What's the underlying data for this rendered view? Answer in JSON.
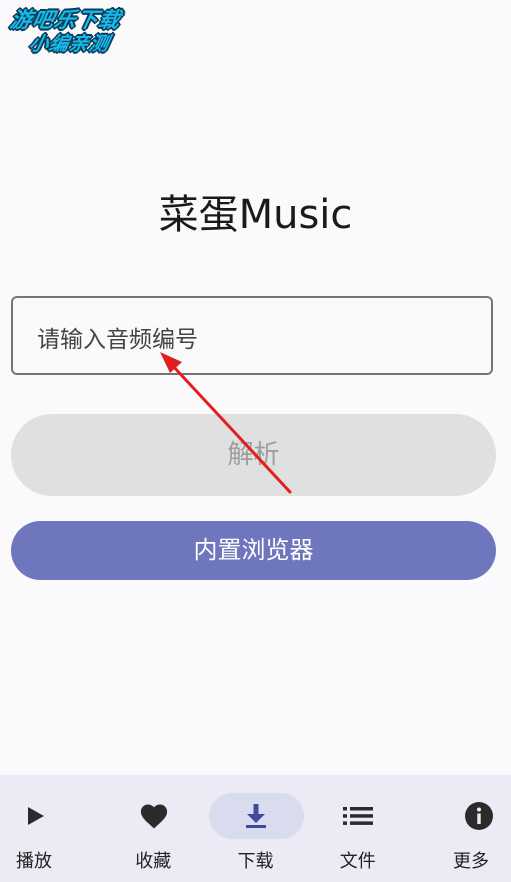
{
  "watermark": {
    "line1": "游吧乐下载",
    "line2": "小编亲测"
  },
  "app": {
    "title": "菜蛋Music"
  },
  "input": {
    "placeholder": "请输入音频编号"
  },
  "buttons": {
    "parse": "解析",
    "browser": "内置浏览器"
  },
  "nav": {
    "items": [
      {
        "label": "播放",
        "icon": "play-icon"
      },
      {
        "label": "收藏",
        "icon": "heart-icon"
      },
      {
        "label": "下载",
        "icon": "download-icon",
        "active": true
      },
      {
        "label": "文件",
        "icon": "list-icon"
      },
      {
        "label": "更多",
        "icon": "info-icon"
      }
    ]
  },
  "colors": {
    "accent": "#6e77bd",
    "active_pill": "#d9dcef",
    "navbar_bg": "#eceaf4",
    "disabled_button": "#e0e0e0",
    "annotation_arrow": "#e02020",
    "icon": "#2b2b2b",
    "active_icon": "#3f4aa0"
  }
}
